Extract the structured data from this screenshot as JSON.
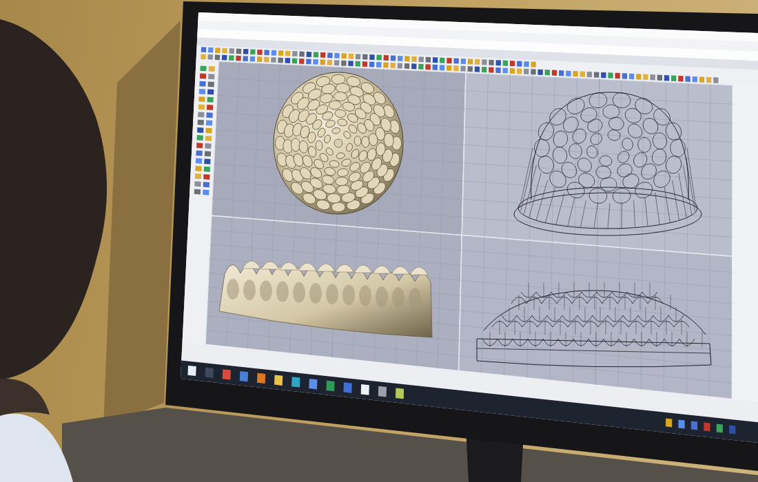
{
  "viewports": [
    {
      "kind": "shaded_top"
    },
    {
      "kind": "wire_perspective"
    },
    {
      "kind": "shaded_front"
    },
    {
      "kind": "wire_side"
    }
  ]
}
